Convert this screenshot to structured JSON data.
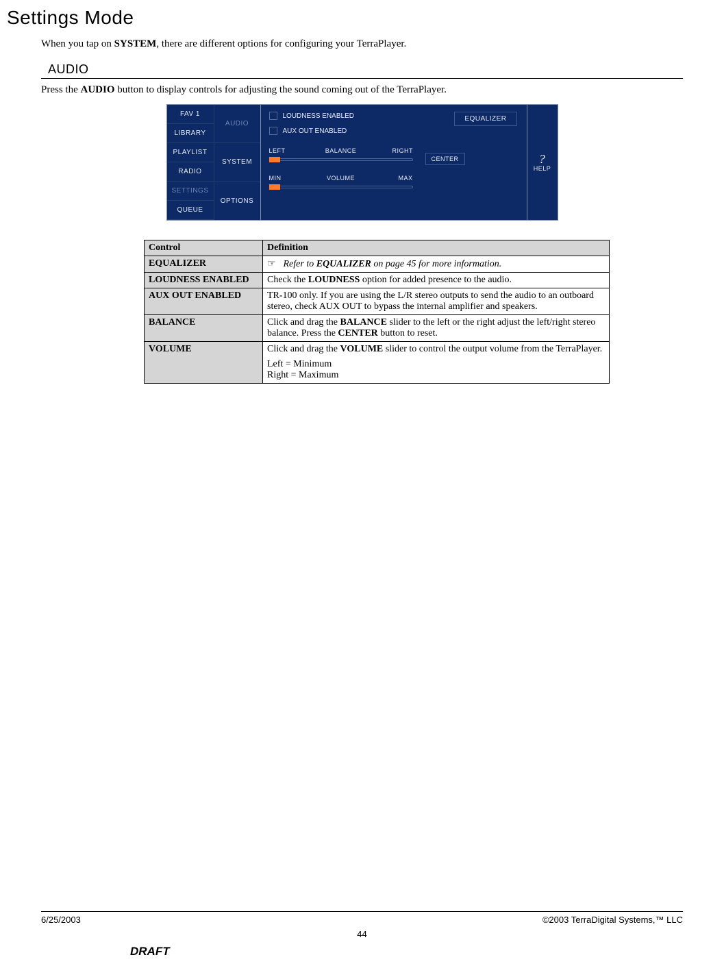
{
  "page": {
    "title": "Settings Mode",
    "section": "AUDIO",
    "intro_pre": "When you tap on ",
    "intro_bold": "SYSTEM",
    "intro_post": ", there are different options for configuring your TerraPlayer.",
    "audio_pre": "Press the ",
    "audio_bold": "AUDIO",
    "audio_post": " button to display controls for adjusting the sound coming out of the TerraPlayer."
  },
  "device": {
    "nav": [
      "FAV 1",
      "LIBRARY",
      "PLAYLIST",
      "RADIO",
      "SETTINGS",
      "QUEUE"
    ],
    "nav_selected": "SETTINGS",
    "tabs": [
      "AUDIO",
      "SYSTEM",
      "OPTIONS"
    ],
    "tab_selected": "AUDIO",
    "checks": {
      "loudness": "LOUDNESS ENABLED",
      "aux": "AUX OUT ENABLED"
    },
    "equalizer_btn": "EQUALIZER",
    "balance": {
      "left": "LEFT",
      "label": "BALANCE",
      "right": "RIGHT",
      "center_btn": "CENTER"
    },
    "volume": {
      "min": "MIN",
      "label": "VOLUME",
      "max": "MAX"
    },
    "help": {
      "mark": "?",
      "label": "HELP"
    }
  },
  "table": {
    "head_control": "Control",
    "head_def": "Definition",
    "rows": {
      "equalizer": {
        "ctl": "EQUALIZER",
        "hand": "☞",
        "text_pre": "Refer to ",
        "text_bold": "EQUALIZER",
        "text_post": " on page 45 for more information."
      },
      "loudness": {
        "ctl": "LOUDNESS ENABLED",
        "pre": "Check the ",
        "bold": "LOUDNESS",
        "post": " option for added presence to the audio."
      },
      "aux": {
        "ctl": "AUX OUT ENABLED",
        "text": "TR-100 only.  If you are using the L/R stereo outputs to send the audio to an outboard stereo, check AUX OUT to bypass the internal amplifier and speakers."
      },
      "balance": {
        "ctl": "BALANCE",
        "pre": "Click and drag the ",
        "bold1": "BALANCE",
        "mid": " slider to the left or the right adjust the left/right stereo balance.  Press the ",
        "bold2": "CENTER",
        "post": " button to reset."
      },
      "volume": {
        "ctl": "VOLUME",
        "pre": "Click and drag the ",
        "bold": "VOLUME",
        "mid": " slider to control the output volume from the TerraPlayer.",
        "l1": "Left = Minimum",
        "l2": "Right = Maximum"
      }
    }
  },
  "footer": {
    "date": "6/25/2003",
    "copyright": "©2003 TerraDigital Systems,™ LLC",
    "page": "44",
    "draft": "DRAFT"
  }
}
